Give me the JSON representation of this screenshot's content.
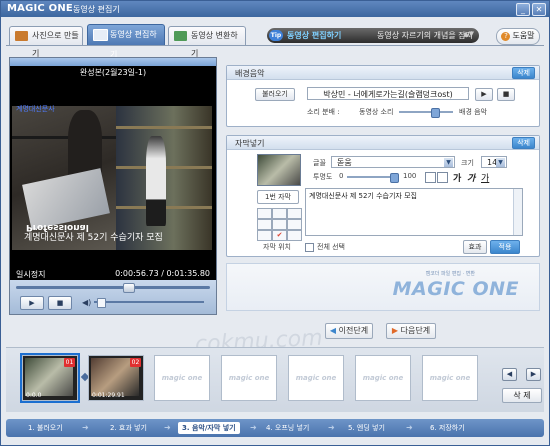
{
  "window": {
    "app_name": "MAGIC ONE",
    "title": "동영상 편집기",
    "minimize_icon": "minimize-icon",
    "close_icon": "close-icon"
  },
  "tabs": [
    {
      "label": "사진으로 만들기",
      "active": false
    },
    {
      "label": "동영상 편집하기",
      "active": true
    },
    {
      "label": "동영상 변환하기",
      "active": false
    }
  ],
  "tip": {
    "badge": "Tip",
    "title": "동영상 편집하기",
    "text": "동영상 자르기의 개념을 잡지",
    "arrow": "▲▼"
  },
  "help": {
    "icon": "?",
    "label": "도움말"
  },
  "preview": {
    "clip_title": "완성본(2월23일-1)",
    "overlay_small": "계명대신문사",
    "overlay_professional": "Professional",
    "overlay_subtitle": "계명대신문사 제 52기 수습기자 모집",
    "status": "일시정지",
    "timecode": "0:00:56.73 / 0:01:35.80",
    "seek_fraction": 0.59,
    "volume_fraction": 0.03,
    "play_icon": "▶",
    "stop_icon": "■"
  },
  "bgm": {
    "title": "배경음악",
    "delete_label": "삭제",
    "open_label": "불러오기",
    "file_name": "박상민 - 너에게로가는길(슬램덩크ost)",
    "play_icon": "▶",
    "stop_icon": "■",
    "balance_label": "소리 분배 :",
    "balance_left": "동영상 소리",
    "balance_right": "배경 음악",
    "balance_fraction": 0.7
  },
  "subtitle": {
    "title": "자막넣기",
    "delete_label": "삭제",
    "font_label": "글꼴",
    "font_value": "돋움",
    "size_label": "크기",
    "size_value": "14",
    "opacity_label": "투명도",
    "opacity_min": "0",
    "opacity_max": "100",
    "opacity_fraction": 1.0,
    "format_labels": [
      "가",
      "가",
      "가"
    ],
    "item_label": "1번 자막",
    "text": "계명대신문사 제 52기 수습기자 모집",
    "position_label": "자막 위치",
    "select_all_label": "전체 선택",
    "effect_label": "효과",
    "apply_label": "적용",
    "text_color": "#000000",
    "selected_position": "bottom-center"
  },
  "logo": {
    "tagline": "캠코더 파일 편집 · 변환",
    "brand": "MAGIC ONE"
  },
  "nav": {
    "prev_label": "이전단계",
    "next_label": "다음단계"
  },
  "timeline": {
    "clips": [
      {
        "number": "01",
        "time": "0:0.0",
        "selected": true
      },
      {
        "number": "02",
        "time": "0:01:29.91",
        "selected": false
      }
    ],
    "empty_label": "magic one",
    "empty_slots": 5,
    "delete_label": "삭 제",
    "left_arrow": "◀",
    "right_arrow": "▶"
  },
  "watermark": "cokmu.com",
  "steps": [
    {
      "label": "1. 불러오기",
      "active": false
    },
    {
      "label": "2. 효과 넣기",
      "active": false
    },
    {
      "label": "3. 음악/자막 넣기",
      "active": true
    },
    {
      "label": "4. 오프닝 넣기",
      "active": false
    },
    {
      "label": "5. 엔딩 넣기",
      "active": false
    },
    {
      "label": "6. 저장하기",
      "active": false
    }
  ],
  "colors": {
    "accent": "#3d679f",
    "active_tab": "#4e79b4",
    "delete_button": "#3c86cc",
    "clip_badge": "#e03030"
  }
}
